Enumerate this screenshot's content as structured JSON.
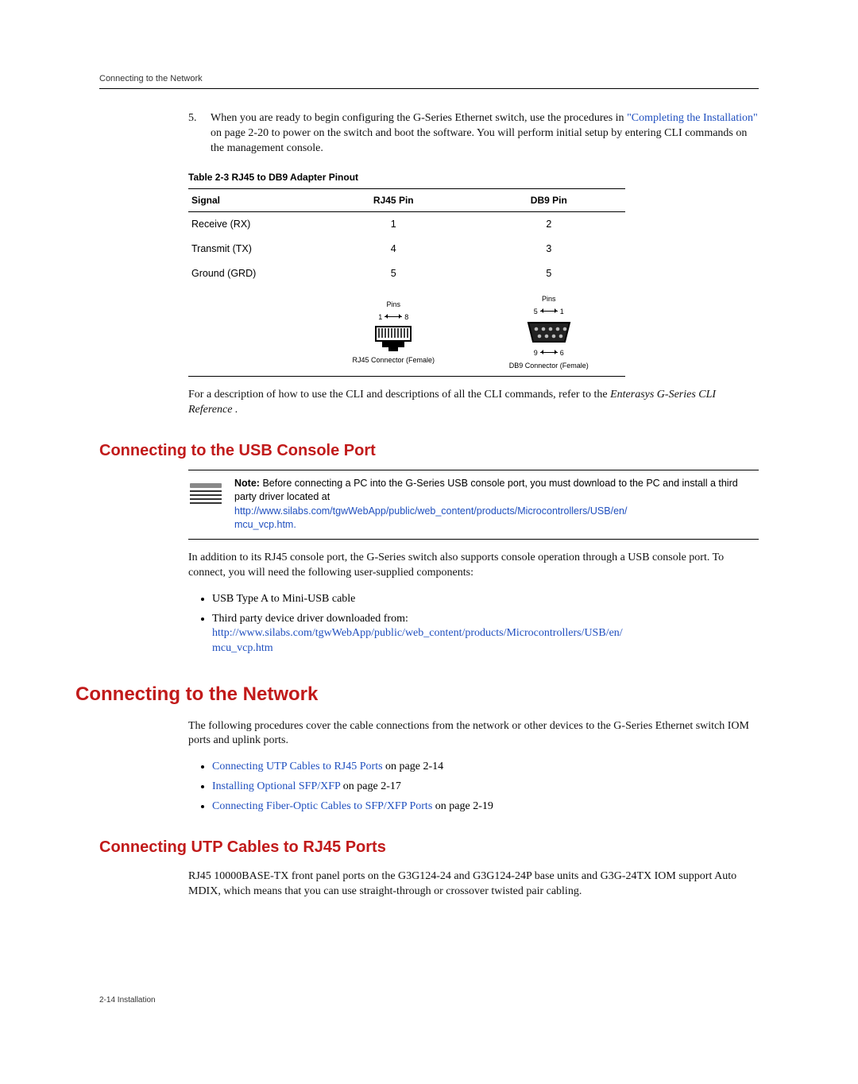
{
  "running_header": "Connecting to the Network",
  "step5": {
    "num": "5.",
    "text_a": "When you are ready to begin configuring the G-Series Ethernet switch, use the procedures in ",
    "link": "\"Completing the Installation\"",
    "text_b": " on page 2-20 to power on the switch and boot the software. You will perform initial setup by entering CLI commands on the management console."
  },
  "table": {
    "caption": "Table 2-3   RJ45 to DB9 Adapter Pinout",
    "headers": [
      "Signal",
      "RJ45 Pin",
      "DB9 Pin"
    ],
    "rows": [
      [
        "Receive (RX)",
        "1",
        "2"
      ],
      [
        "Transmit (TX)",
        "4",
        "3"
      ],
      [
        "Ground (GRD)",
        "5",
        "5"
      ]
    ],
    "rj45": {
      "pins_label": "Pins",
      "left": "1",
      "right": "8",
      "caption": "RJ45 Connector (Female)"
    },
    "db9": {
      "pins_label": "Pins",
      "top_left": "5",
      "top_right": "1",
      "bot_left": "9",
      "bot_right": "6",
      "caption": "DB9  Connector  (Female)"
    }
  },
  "cli_para_a": "For a description of how to use the CLI and descriptions of all the CLI commands, refer to the ",
  "cli_para_em": "Enterasys G-Series CLI Reference .",
  "h2_usb": "Connecting to the USB Console Port",
  "note": {
    "bold": "Note:",
    "body_a": " Before connecting a PC into the G-Series USB console port, you must download to the PC and install a third party driver located at",
    "link1": "http://www.silabs.com/tgwWebApp/public/web_content/products/Microcontrollers/USB/en/",
    "link2": "mcu_vcp.htm."
  },
  "usb_intro": "In addition to its RJ45 console port, the G-Series switch also supports console operation through a USB console port. To connect, you will need the following user-supplied components:",
  "usb_bullets": {
    "b1": "USB Type A to Mini-USB cable",
    "b2a": "Third party device driver downloaded from:",
    "b2link1": "http://www.silabs.com/tgwWebApp/public/web_content/products/Microcontrollers/USB/en/",
    "b2link2": "mcu_vcp.htm"
  },
  "h1_net": "Connecting to the Network",
  "net_intro": "The following procedures cover the cable connections from the network or other devices to the G-Series Ethernet switch IOM ports and uplink ports.",
  "net_bullets": {
    "b1a": "Connecting UTP Cables to RJ45 Ports",
    "b1b": " on page 2-14",
    "b2a": "Installing Optional SFP/XFP",
    "b2b": " on page 2-17",
    "b3a": "Connecting Fiber-Optic Cables to SFP/XFP Ports",
    "b3b": " on page 2-19"
  },
  "h2_utp": "Connecting UTP Cables to RJ45 Ports",
  "utp_body": "RJ45 10000BASE-TX front panel ports on the G3G124-24 and G3G124-24P base units and G3G-24TX IOM support Auto MDIX, which means that you can use straight-through or crossover twisted pair cabling.",
  "footer": "2-14   Installation"
}
